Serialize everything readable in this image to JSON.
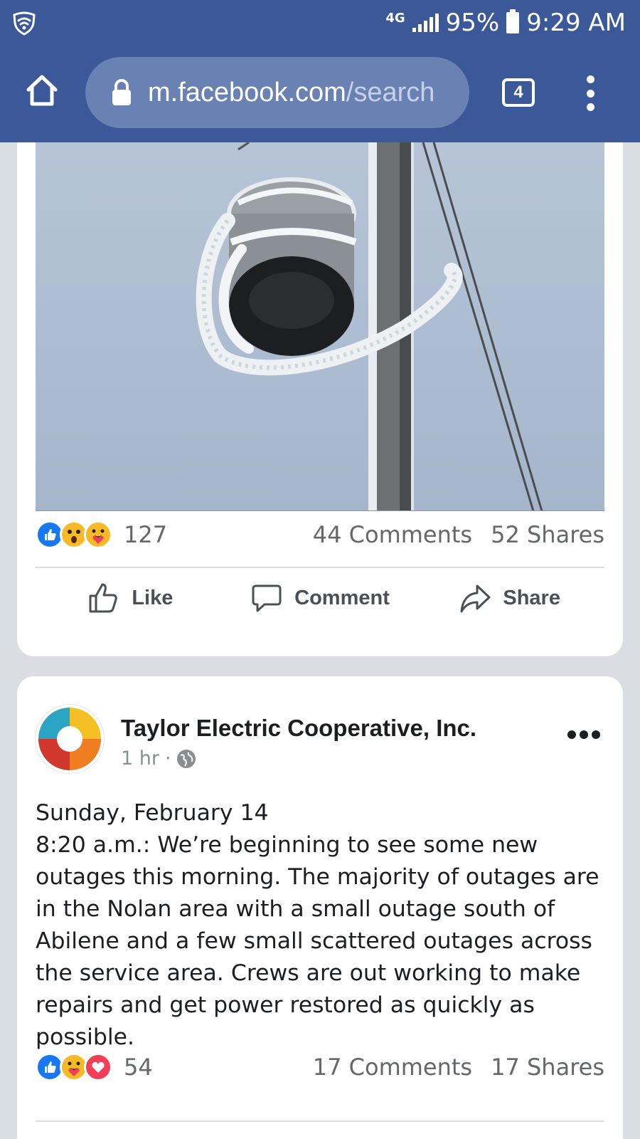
{
  "status_bar": {
    "network": "4G",
    "battery": "95%",
    "time": "9:29 AM"
  },
  "browser": {
    "url_host": "m.facebook.com",
    "url_path": "/search",
    "tab_count": "4"
  },
  "post1": {
    "reaction_count": "127",
    "comments": "44 Comments",
    "shares": "52 Shares",
    "actions": {
      "like": "Like",
      "comment": "Comment",
      "share": "Share"
    }
  },
  "post2": {
    "page_name": "Taylor Electric Cooperative, Inc.",
    "time": "1 hr",
    "meta_separator": "·",
    "text_line1": "Sunday, February 14",
    "text_body": "8:20 a.m.: We’re beginning to see some new outages this morning. The majority of outages are in the Nolan area with a small outage south of Abilene and a few small scattered outages across the service area. Crews are out working to make repairs and get power restored as quickly as possible.",
    "reaction_count": "54",
    "comments": "17 Comments",
    "shares": "17 Shares"
  },
  "colors": {
    "chrome": "#3b5998",
    "like_blue": "#1877f2",
    "love_red": "#f33e58",
    "emoji_yellow": "#f7b928"
  },
  "icons": [
    "wifi-shield-icon",
    "signal-icon",
    "battery-icon",
    "home-icon",
    "lock-icon",
    "tabs-icon",
    "menu-dots-icon",
    "like-reaction-icon",
    "wow-reaction-icon",
    "care-reaction-icon",
    "love-reaction-icon",
    "thumbs-up-icon",
    "comment-bubble-icon",
    "share-arrow-icon",
    "globe-icon",
    "more-dots-icon"
  ]
}
